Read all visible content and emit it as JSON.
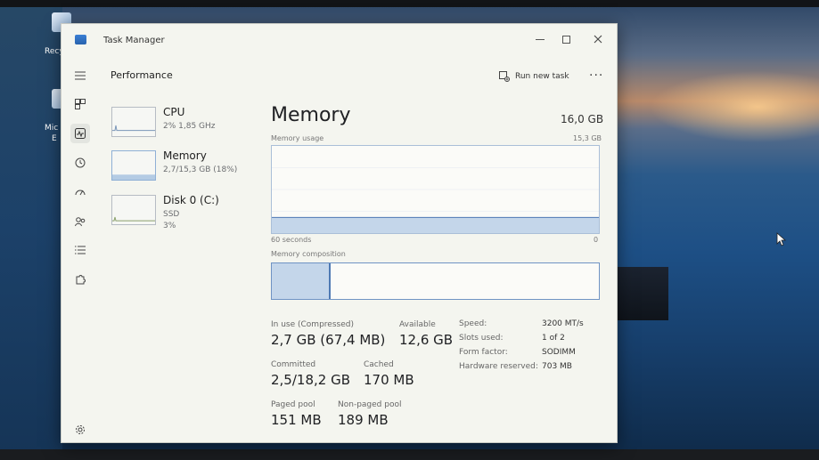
{
  "desktop": {
    "icon_labels": [
      "Recy",
      "Mic",
      "E"
    ]
  },
  "window": {
    "title": "Task Manager"
  },
  "header": {
    "page_title": "Performance",
    "run_new_task": "Run new task",
    "more": "···"
  },
  "side_panel": {
    "items": [
      {
        "name": "CPU",
        "sub1": "2%  1,85 GHz",
        "sub2": "",
        "level": 0.02
      },
      {
        "name": "Memory",
        "sub1": "2,7/15,3 GB (18%)",
        "sub2": "",
        "level": 0.18
      },
      {
        "name": "Disk 0 (C:)",
        "sub1": "SSD",
        "sub2": "3%",
        "level": 0.03
      }
    ]
  },
  "main": {
    "title": "Memory",
    "total": "16,0 GB",
    "usage_label": "Memory usage",
    "usage_max": "15,3 GB",
    "time_left": "60 seconds",
    "time_right": "0",
    "composition_label": "Memory composition",
    "composition_in_use_fraction": 0.18,
    "stats": {
      "in_use_label": "In use (Compressed)",
      "in_use_value": "2,7 GB (67,4 MB)",
      "available_label": "Available",
      "available_value": "12,6 GB",
      "committed_label": "Committed",
      "committed_value": "2,5/18,2 GB",
      "cached_label": "Cached",
      "cached_value": "170 MB",
      "paged_label": "Paged pool",
      "paged_value": "151 MB",
      "nonpaged_label": "Non-paged pool",
      "nonpaged_value": "189 MB"
    },
    "details": {
      "speed_label": "Speed:",
      "speed_value": "3200 MT/s",
      "slots_label": "Slots used:",
      "slots_value": "1 of 2",
      "form_label": "Form factor:",
      "form_value": "SODIMM",
      "reserved_label": "Hardware reserved:",
      "reserved_value": "703 MB"
    }
  },
  "colors": {
    "accent": "#4e79b3",
    "fill": "#c4d6ea",
    "window_bg": "#f4f5ef"
  }
}
